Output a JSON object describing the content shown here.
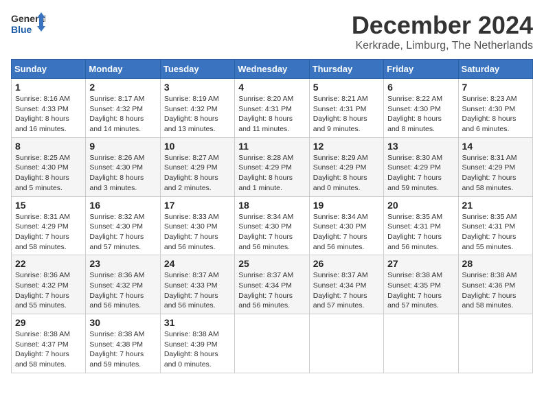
{
  "header": {
    "logo_line1": "General",
    "logo_line2": "Blue",
    "title": "December 2024",
    "subtitle": "Kerkrade, Limburg, The Netherlands"
  },
  "weekdays": [
    "Sunday",
    "Monday",
    "Tuesday",
    "Wednesday",
    "Thursday",
    "Friday",
    "Saturday"
  ],
  "weeks": [
    [
      {
        "day": "1",
        "sunrise": "8:16 AM",
        "sunset": "4:33 PM",
        "daylight": "8 hours and 16 minutes."
      },
      {
        "day": "2",
        "sunrise": "8:17 AM",
        "sunset": "4:32 PM",
        "daylight": "8 hours and 14 minutes."
      },
      {
        "day": "3",
        "sunrise": "8:19 AM",
        "sunset": "4:32 PM",
        "daylight": "8 hours and 13 minutes."
      },
      {
        "day": "4",
        "sunrise": "8:20 AM",
        "sunset": "4:31 PM",
        "daylight": "8 hours and 11 minutes."
      },
      {
        "day": "5",
        "sunrise": "8:21 AM",
        "sunset": "4:31 PM",
        "daylight": "8 hours and 9 minutes."
      },
      {
        "day": "6",
        "sunrise": "8:22 AM",
        "sunset": "4:30 PM",
        "daylight": "8 hours and 8 minutes."
      },
      {
        "day": "7",
        "sunrise": "8:23 AM",
        "sunset": "4:30 PM",
        "daylight": "8 hours and 6 minutes."
      }
    ],
    [
      {
        "day": "8",
        "sunrise": "8:25 AM",
        "sunset": "4:30 PM",
        "daylight": "8 hours and 5 minutes."
      },
      {
        "day": "9",
        "sunrise": "8:26 AM",
        "sunset": "4:30 PM",
        "daylight": "8 hours and 3 minutes."
      },
      {
        "day": "10",
        "sunrise": "8:27 AM",
        "sunset": "4:29 PM",
        "daylight": "8 hours and 2 minutes."
      },
      {
        "day": "11",
        "sunrise": "8:28 AM",
        "sunset": "4:29 PM",
        "daylight": "8 hours and 1 minute."
      },
      {
        "day": "12",
        "sunrise": "8:29 AM",
        "sunset": "4:29 PM",
        "daylight": "8 hours and 0 minutes."
      },
      {
        "day": "13",
        "sunrise": "8:30 AM",
        "sunset": "4:29 PM",
        "daylight": "7 hours and 59 minutes."
      },
      {
        "day": "14",
        "sunrise": "8:31 AM",
        "sunset": "4:29 PM",
        "daylight": "7 hours and 58 minutes."
      }
    ],
    [
      {
        "day": "15",
        "sunrise": "8:31 AM",
        "sunset": "4:29 PM",
        "daylight": "7 hours and 58 minutes."
      },
      {
        "day": "16",
        "sunrise": "8:32 AM",
        "sunset": "4:30 PM",
        "daylight": "7 hours and 57 minutes."
      },
      {
        "day": "17",
        "sunrise": "8:33 AM",
        "sunset": "4:30 PM",
        "daylight": "7 hours and 56 minutes."
      },
      {
        "day": "18",
        "sunrise": "8:34 AM",
        "sunset": "4:30 PM",
        "daylight": "7 hours and 56 minutes."
      },
      {
        "day": "19",
        "sunrise": "8:34 AM",
        "sunset": "4:30 PM",
        "daylight": "7 hours and 56 minutes."
      },
      {
        "day": "20",
        "sunrise": "8:35 AM",
        "sunset": "4:31 PM",
        "daylight": "7 hours and 56 minutes."
      },
      {
        "day": "21",
        "sunrise": "8:35 AM",
        "sunset": "4:31 PM",
        "daylight": "7 hours and 55 minutes."
      }
    ],
    [
      {
        "day": "22",
        "sunrise": "8:36 AM",
        "sunset": "4:32 PM",
        "daylight": "7 hours and 55 minutes."
      },
      {
        "day": "23",
        "sunrise": "8:36 AM",
        "sunset": "4:32 PM",
        "daylight": "7 hours and 56 minutes."
      },
      {
        "day": "24",
        "sunrise": "8:37 AM",
        "sunset": "4:33 PM",
        "daylight": "7 hours and 56 minutes."
      },
      {
        "day": "25",
        "sunrise": "8:37 AM",
        "sunset": "4:34 PM",
        "daylight": "7 hours and 56 minutes."
      },
      {
        "day": "26",
        "sunrise": "8:37 AM",
        "sunset": "4:34 PM",
        "daylight": "7 hours and 57 minutes."
      },
      {
        "day": "27",
        "sunrise": "8:38 AM",
        "sunset": "4:35 PM",
        "daylight": "7 hours and 57 minutes."
      },
      {
        "day": "28",
        "sunrise": "8:38 AM",
        "sunset": "4:36 PM",
        "daylight": "7 hours and 58 minutes."
      }
    ],
    [
      {
        "day": "29",
        "sunrise": "8:38 AM",
        "sunset": "4:37 PM",
        "daylight": "7 hours and 58 minutes."
      },
      {
        "day": "30",
        "sunrise": "8:38 AM",
        "sunset": "4:38 PM",
        "daylight": "7 hours and 59 minutes."
      },
      {
        "day": "31",
        "sunrise": "8:38 AM",
        "sunset": "4:39 PM",
        "daylight": "8 hours and 0 minutes."
      },
      null,
      null,
      null,
      null
    ]
  ]
}
